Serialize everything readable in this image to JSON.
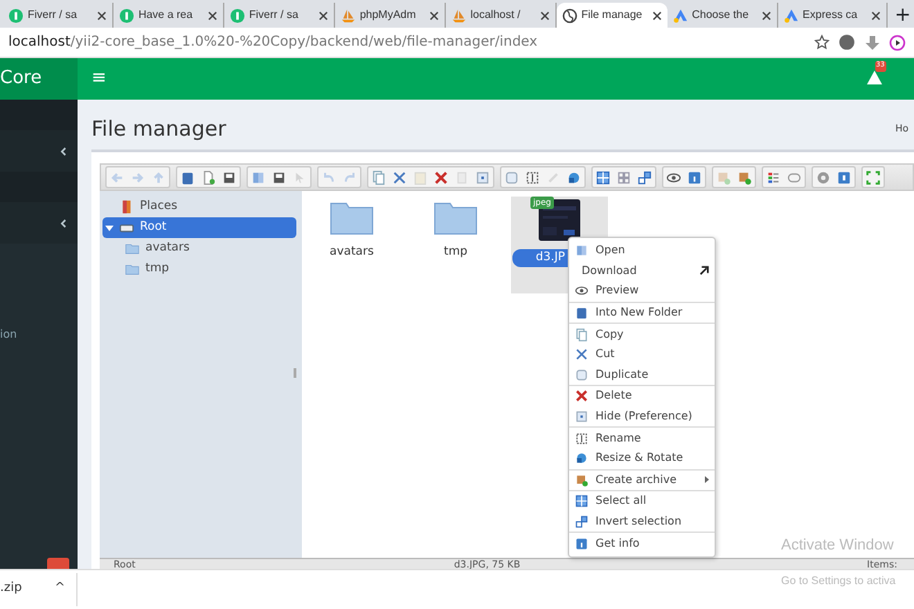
{
  "browser": {
    "tabs": [
      {
        "label": "Fiverr / sa",
        "kind": "fiverr",
        "selected": false
      },
      {
        "label": "Have a rea",
        "kind": "fiverr",
        "selected": false
      },
      {
        "label": "Fiverr / sa",
        "kind": "fiverr",
        "selected": false
      },
      {
        "label": "phpMyAdm",
        "kind": "pma",
        "selected": false
      },
      {
        "label": "localhost /",
        "kind": "pma",
        "selected": false
      },
      {
        "label": "File manage",
        "kind": "globe",
        "selected": true
      },
      {
        "label": "Choose the",
        "kind": "ads",
        "selected": false
      },
      {
        "label": "Express ca",
        "kind": "ads",
        "selected": false
      }
    ],
    "new_tab": "+",
    "address": {
      "host": "localhost",
      "path": "/yii2-core_base_1.0%20-%20Copy/backend/web/file-manager/index"
    }
  },
  "app": {
    "brand": "Core",
    "menu": "≡",
    "alert_count": "33",
    "breadcrumb": "Ho",
    "sidebar": {
      "items": [
        {
          "kind": "band"
        },
        {
          "kind": "chevron"
        },
        {
          "kind": "band"
        },
        {
          "kind": "chevron"
        },
        {
          "kind": "text",
          "label": "ion"
        },
        {
          "kind": "badge"
        }
      ]
    },
    "page_title": "File manager"
  },
  "file_manager": {
    "toolbar": [
      [
        {
          "kind": "back",
          "disabled": true
        },
        {
          "kind": "forward",
          "disabled": true
        },
        {
          "kind": "up",
          "disabled": true
        }
      ],
      [
        {
          "kind": "mkdir",
          "disabled": false
        },
        {
          "kind": "mkfile",
          "disabled": false
        },
        {
          "kind": "save",
          "disabled": false
        }
      ],
      [
        {
          "kind": "open",
          "disabled": false
        },
        {
          "kind": "save",
          "disabled": false
        },
        {
          "kind": "pointer",
          "disabled": true
        }
      ],
      [
        {
          "kind": "undo",
          "disabled": true
        },
        {
          "kind": "redo",
          "disabled": true
        }
      ],
      [
        {
          "kind": "copy",
          "disabled": false
        },
        {
          "kind": "cut",
          "disabled": false
        },
        {
          "kind": "paste",
          "disabled": true
        },
        {
          "kind": "delete",
          "disabled": false
        },
        {
          "kind": "page",
          "disabled": true
        },
        {
          "kind": "hide",
          "disabled": false
        }
      ],
      [
        {
          "kind": "duplicate",
          "disabled": false
        },
        {
          "kind": "rename",
          "disabled": false
        },
        {
          "kind": "edit",
          "disabled": true
        },
        {
          "kind": "resize",
          "disabled": false
        }
      ],
      [
        {
          "kind": "grid",
          "disabled": false
        },
        {
          "kind": "list",
          "disabled": false
        },
        {
          "kind": "invert",
          "disabled": false
        }
      ],
      [
        {
          "kind": "eye",
          "disabled": false
        },
        {
          "kind": "info",
          "disabled": false
        }
      ],
      [
        {
          "kind": "archive",
          "disabled": true
        },
        {
          "kind": "archive",
          "disabled": false
        }
      ],
      [
        {
          "kind": "sort",
          "disabled": false
        },
        {
          "kind": "pill",
          "disabled": false
        }
      ],
      [
        {
          "kind": "gear",
          "disabled": false
        },
        {
          "kind": "help",
          "disabled": false
        }
      ],
      [
        {
          "kind": "fullscreen",
          "disabled": false
        }
      ]
    ],
    "tree": [
      {
        "label": "Places",
        "kind": "places",
        "selected": false
      },
      {
        "label": "Root",
        "kind": "drive",
        "selected": true,
        "expanded": true,
        "children": [
          {
            "label": "avatars",
            "kind": "folder",
            "selected": false
          },
          {
            "label": "tmp",
            "kind": "folder",
            "selected": false
          }
        ]
      }
    ],
    "files": [
      {
        "name": "avatars",
        "kind": "folder",
        "selected": false
      },
      {
        "name": "tmp",
        "kind": "folder",
        "selected": false
      },
      {
        "name": "d3.JP",
        "kind": "picture",
        "badge": "jpeg",
        "selected": true
      }
    ],
    "context_menu": [
      [
        {
          "label": "Open",
          "kind": "open",
          "submenu": false
        },
        {
          "label": "Download",
          "kind": "download",
          "submenu": false
        },
        {
          "label": "Preview",
          "kind": "eye",
          "submenu": false
        }
      ],
      [
        {
          "label": "Into New Folder",
          "kind": "mkdir",
          "submenu": false
        }
      ],
      [
        {
          "label": "Copy",
          "kind": "copy",
          "submenu": false
        },
        {
          "label": "Cut",
          "kind": "cut",
          "submenu": false
        },
        {
          "label": "Duplicate",
          "kind": "duplicate",
          "submenu": false
        }
      ],
      [
        {
          "label": "Delete",
          "kind": "delete",
          "submenu": false
        },
        {
          "label": "Hide (Preference)",
          "kind": "hide",
          "submenu": false
        }
      ],
      [
        {
          "label": "Rename",
          "kind": "rename",
          "submenu": false
        },
        {
          "label": "Resize & Rotate",
          "kind": "resize",
          "submenu": false
        }
      ],
      [
        {
          "label": "Create archive",
          "kind": "archive",
          "submenu": true
        }
      ],
      [
        {
          "label": "Select all",
          "kind": "grid",
          "submenu": false
        },
        {
          "label": "Invert selection",
          "kind": "invert",
          "submenu": false
        }
      ],
      [
        {
          "label": "Get info",
          "kind": "info",
          "submenu": false
        }
      ]
    ],
    "status_bar": {
      "path": "Root",
      "selection": "d3.JPG, 75 KB",
      "count": "Items:"
    }
  },
  "os_notice": {
    "title": "Activate Window",
    "subtitle": "Go to Settings to activa"
  },
  "download_bar": {
    "file": ".zip",
    "caret": "^"
  }
}
